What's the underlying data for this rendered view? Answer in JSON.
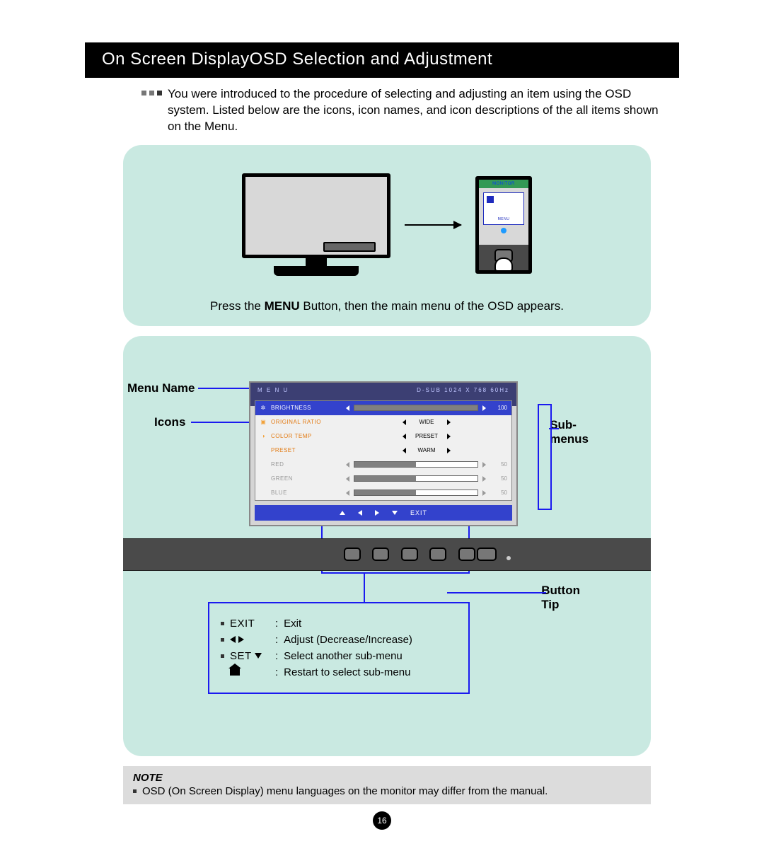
{
  "title": "On Screen DisplayOSD Selection and Adjustment",
  "intro": "You were introduced to the procedure of selecting and adjusting an item using the OSD system. Listed below are the icons, icon names, and icon descriptions of the all items shown on the Menu.",
  "panel1": {
    "zoom_header": "MONITOR",
    "zoom_menu_label": "MENU",
    "press_pre": "Press the ",
    "press_bold": "MENU",
    "press_post": " Button, then the main menu of the OSD appears."
  },
  "panel2": {
    "callouts": {
      "menu_name": "Menu Name",
      "icons": "Icons",
      "submenus_1": "Sub-",
      "submenus_2": "menus",
      "button_tip_1": "Button",
      "button_tip_2": "Tip"
    },
    "osd": {
      "menu_label": "M E N U",
      "signal": "D-SUB 1024 X 768 60Hz",
      "rows": [
        {
          "name": "BRIGHTNESS",
          "type": "slider",
          "value": 100,
          "highlight": true
        },
        {
          "name": "ORIGINAL RATIO",
          "type": "choice",
          "value": "WIDE",
          "orange": true
        },
        {
          "name": "COLOR TEMP",
          "type": "choice",
          "value": "PRESET",
          "orange": true
        },
        {
          "name": "PRESET",
          "type": "choice",
          "value": "WARM",
          "orange": true
        },
        {
          "name": "RED",
          "type": "slider",
          "value": 50,
          "grey": true
        },
        {
          "name": "GREEN",
          "type": "slider",
          "value": 50,
          "grey": true
        },
        {
          "name": "BLUE",
          "type": "slider",
          "value": 50,
          "grey": true
        }
      ],
      "exit_label": "EXIT"
    },
    "tips": {
      "exit_key": "EXIT",
      "exit_val": "Exit",
      "adjust_val": "Adjust (Decrease/Increase)",
      "set_key": "SET",
      "set_val": "Select another sub-menu",
      "restart_val": "Restart to select sub-menu"
    }
  },
  "note": {
    "label": "NOTE",
    "text": "OSD (On Screen Display) menu languages on the monitor may differ from the manual."
  },
  "page_number": "16"
}
